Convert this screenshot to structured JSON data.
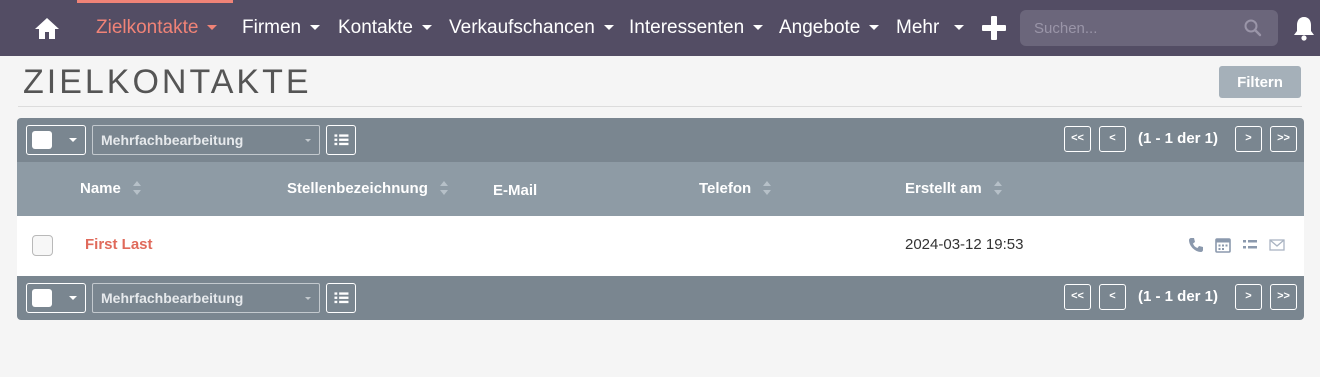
{
  "nav": {
    "items": [
      {
        "label": "Zielkontakte",
        "active": true
      },
      {
        "label": "Firmen"
      },
      {
        "label": "Kontakte"
      },
      {
        "label": "Verkaufschancen"
      },
      {
        "label": "Interessenten"
      },
      {
        "label": "Angebote"
      },
      {
        "label": "Mehr"
      }
    ],
    "search_placeholder": "Suchen...",
    "icons": [
      "home-icon",
      "plus-icon",
      "search-icon",
      "bell-icon"
    ]
  },
  "page": {
    "title": "ZIELKONTAKTE",
    "filter_label": "Filtern"
  },
  "list": {
    "mass_update_label": "Mehrfachbearbeitung",
    "pagination": {
      "first": "<<",
      "prev": "<",
      "count": "(1 - 1 der 1)",
      "next": ">",
      "last": ">>"
    },
    "columns": [
      "Name",
      "Stellenbezeichnung",
      "E-Mail",
      "Telefon",
      "Erstellt am"
    ],
    "rows": [
      {
        "name": "First Last",
        "title": "",
        "email": "",
        "phone": "",
        "created": "2024-03-12 19:53"
      }
    ],
    "row_action_icons": [
      "phone-icon",
      "calendar-icon",
      "task-list-icon",
      "email-icon"
    ]
  },
  "colors": {
    "navbar": "#534d64",
    "accent": "#f08377",
    "panel": "#7a8690",
    "header": "#8e9ba5",
    "link": "#e06a5b"
  }
}
